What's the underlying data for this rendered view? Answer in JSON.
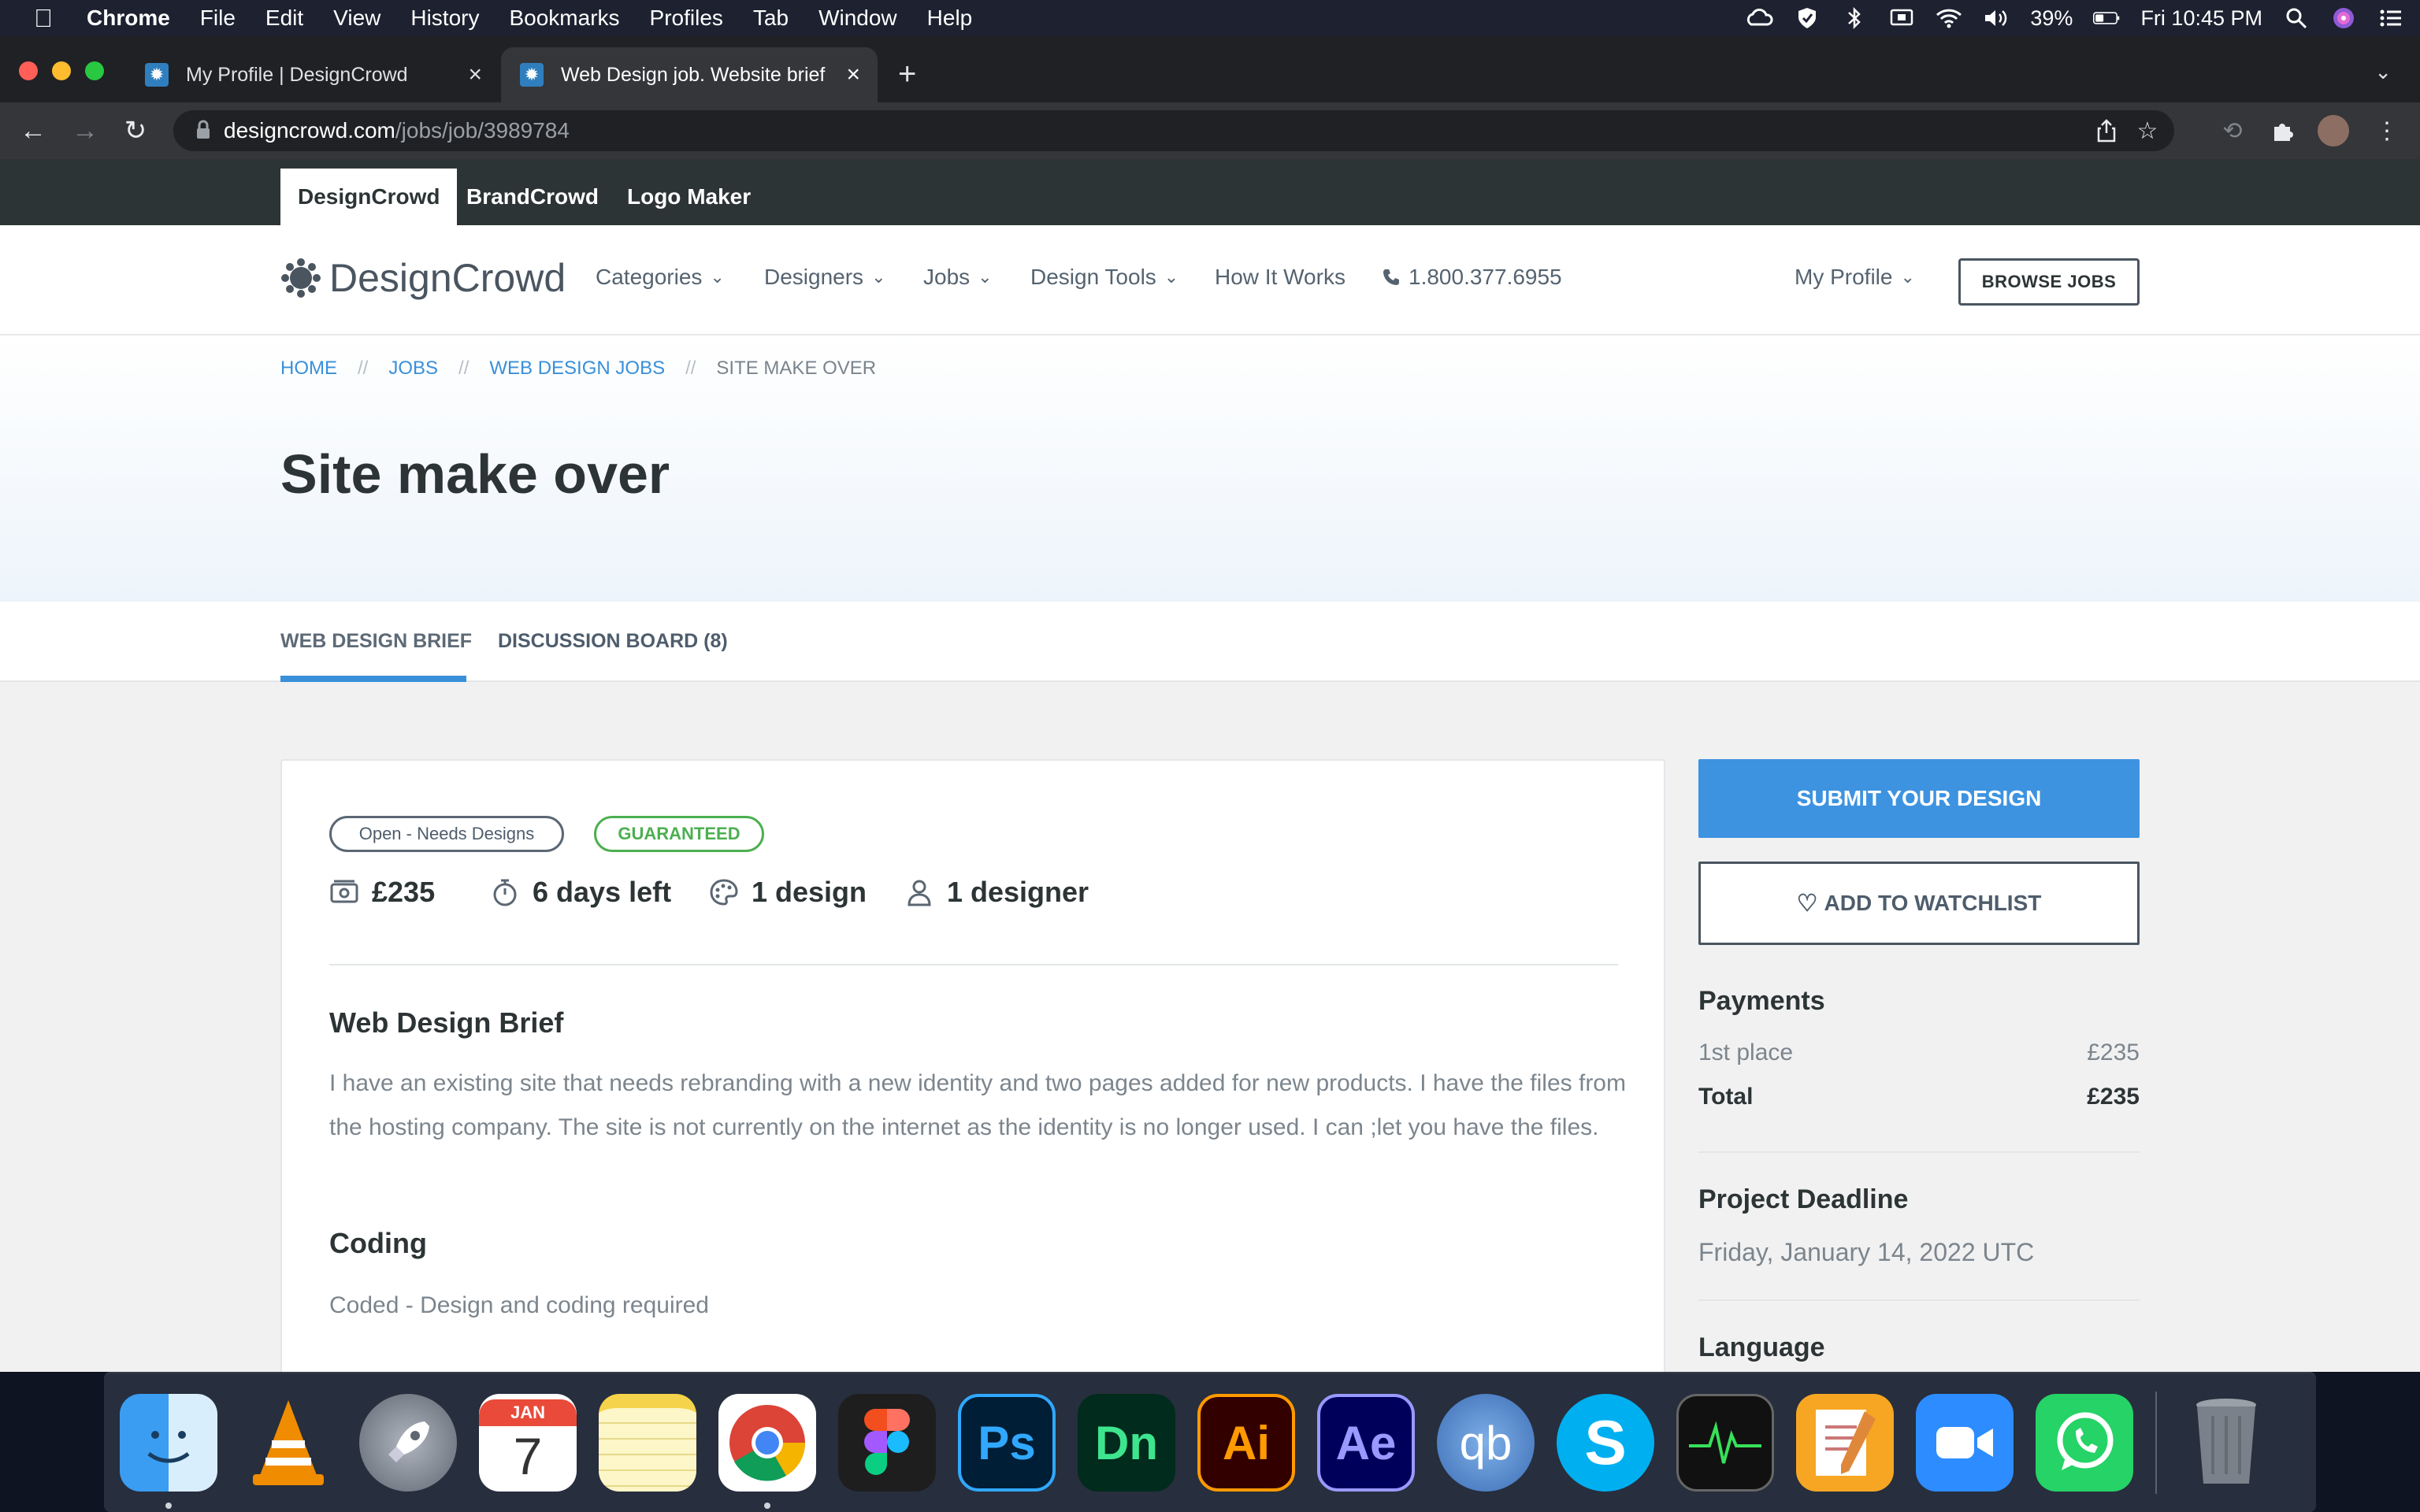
{
  "menubar": {
    "app_name": "Chrome",
    "items": [
      "File",
      "Edit",
      "View",
      "History",
      "Bookmarks",
      "Profiles",
      "Tab",
      "Window",
      "Help"
    ],
    "battery": "39%",
    "clock": "Fri 10:45 PM"
  },
  "browser": {
    "tabs": [
      {
        "title": "My Profile | DesignCrowd"
      },
      {
        "title": "Web Design job. Website brief"
      }
    ],
    "url_host": "designcrowd.com",
    "url_path": "/jobs/job/3989784"
  },
  "brandbar": {
    "tabs": [
      "DesignCrowd",
      "BrandCrowd",
      "Logo Maker"
    ]
  },
  "nav": {
    "logo": "DesignCrowd",
    "links": [
      "Categories",
      "Designers",
      "Jobs",
      "Design Tools",
      "How It Works"
    ],
    "phone": "1.800.377.6955",
    "profile": "My Profile",
    "browse_jobs": "BROWSE JOBS"
  },
  "breadcrumb": {
    "home": "HOME",
    "jobs": "JOBS",
    "web_design_jobs": "WEB DESIGN JOBS",
    "current": "SITE MAKE OVER",
    "separator": "//"
  },
  "page_title": "Site make over",
  "subtabs": {
    "brief": "WEB DESIGN BRIEF",
    "discussion": "DISCUSSION BOARD (8)"
  },
  "job": {
    "status_badge": "Open - Needs Designs",
    "guaranteed_badge": "GUARANTEED",
    "prize": "£235",
    "time_left": "6 days left",
    "designs": "1 design",
    "designers": "1 designer",
    "brief_title": "Web Design Brief",
    "brief_text": "I have an existing site that needs rebranding with a new identity and two pages added for new products. I have the files from the hosting company. The site is not currently on the internet as the identity is no longer used. I can ;let you have the files.",
    "coding_title": "Coding",
    "coding_text": "Coded - Design and coding required"
  },
  "sidebar": {
    "submit": "SUBMIT YOUR DESIGN",
    "watchlist": "ADD TO WATCHLIST",
    "payments_title": "Payments",
    "first_place_label": "1st place",
    "first_place_value": "£235",
    "total_label": "Total",
    "total_value": "£235",
    "deadline_title": "Project Deadline",
    "deadline_value": "Friday, January 14, 2022 UTC",
    "language_title": "Language"
  },
  "dock": {
    "calendar_month": "JAN",
    "calendar_day": "7",
    "photoshop": "Ps",
    "dimension": "Dn",
    "illustrator": "Ai",
    "after_effects": "Ae",
    "qbittorrent": "qb",
    "skype": "S"
  },
  "colors": {
    "accent_blue": "#3d93e0",
    "guaranteed_green": "#4caf50",
    "brand_dark": "#2d3436"
  }
}
